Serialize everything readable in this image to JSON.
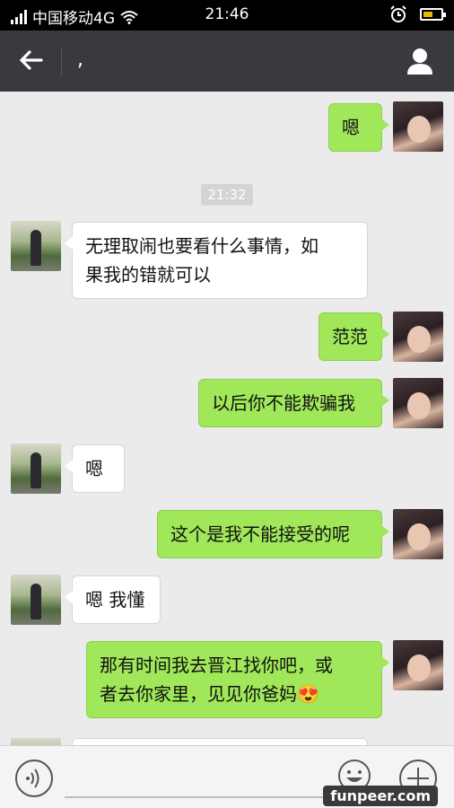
{
  "status_bar": {
    "carrier": "中国移动4G",
    "time": "21:46"
  },
  "header": {
    "title": ","
  },
  "chat": {
    "timestamp": "21:32",
    "messages": [
      {
        "from": "me",
        "text": "嗯"
      },
      {
        "from": "them",
        "text": "无理取闹也要看什么事情，如\n果我的错就可以"
      },
      {
        "from": "me",
        "text": "范范"
      },
      {
        "from": "me",
        "text": "以后你不能欺骗我"
      },
      {
        "from": "them",
        "text": "嗯"
      },
      {
        "from": "me",
        "text": "这个是我不能接受的呢"
      },
      {
        "from": "them",
        "text": "嗯 我懂"
      },
      {
        "from": "me",
        "text": "那有时间我去晋江找你吧，或\n者去你家里，见见你爸妈😍"
      }
    ]
  },
  "watermark": "funpeer.com",
  "colors": {
    "outgoing_bubble": "#a0e75a",
    "incoming_bubble": "#ffffff",
    "header": "#393a3f",
    "background": "#ebebeb"
  },
  "icons": [
    "back-arrow-icon",
    "profile-icon",
    "voice-icon",
    "emoji-icon",
    "plus-icon",
    "wifi-icon",
    "alarm-icon",
    "battery-icon",
    "signal-icon"
  ]
}
